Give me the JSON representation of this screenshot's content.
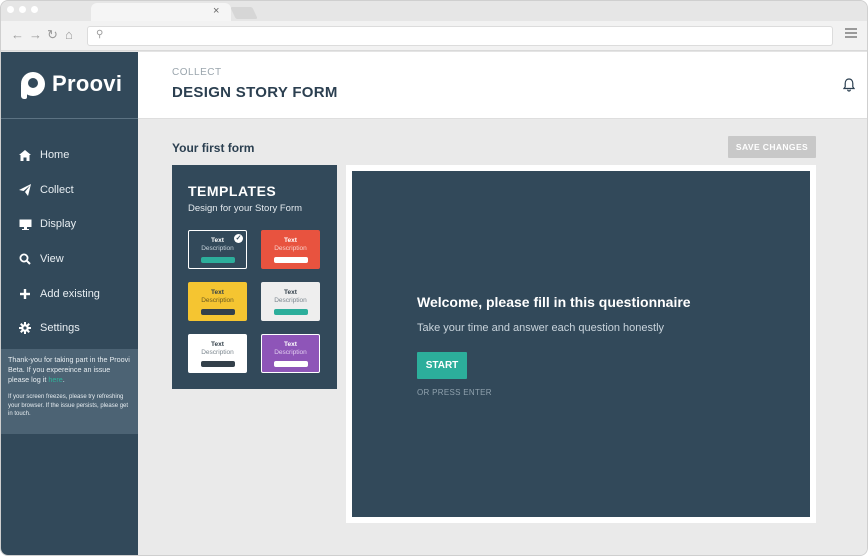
{
  "browser": {
    "tab_close": "×",
    "search_icon": "⚲"
  },
  "brand": {
    "name": "Proovi"
  },
  "sidebar": {
    "items": [
      {
        "label": "Home",
        "icon": "home-icon"
      },
      {
        "label": "Collect",
        "icon": "paper-plane-icon"
      },
      {
        "label": "Display",
        "icon": "monitor-icon"
      },
      {
        "label": "View",
        "icon": "search-icon"
      },
      {
        "label": "Add existing",
        "icon": "plus-icon"
      },
      {
        "label": "Settings",
        "icon": "gear-icon"
      }
    ],
    "notice": {
      "text": "Thank-you for taking part in the Proovi Beta. If you expereince an issue please log it ",
      "link": "here",
      "after_link": ".",
      "small": "If your screen freezes, please try refreshing your browser. If the issue persists, please get in touch."
    }
  },
  "header": {
    "kicker": "COLLECT",
    "title": "DESIGN STORY FORM"
  },
  "form": {
    "title": "Your first form",
    "save_label": "SAVE CHANGES"
  },
  "templates": {
    "heading": "TEMPLATES",
    "subheading": "Design for your Story Form",
    "cards": [
      {
        "title": "Text",
        "desc": "Description",
        "bg": "#32495a",
        "border": "#ffffff",
        "text": "#ffffff",
        "desc_color": "#c5d1d9",
        "bar": "#2cae9b",
        "selected": true
      },
      {
        "title": "Text",
        "desc": "Description",
        "bg": "#e8533f",
        "border": "#e8533f",
        "text": "#ffffff",
        "desc_color": "#f9d2cb",
        "bar": "#ffffff",
        "selected": false
      },
      {
        "title": "Text",
        "desc": "Description",
        "bg": "#f5c531",
        "border": "#f5c531",
        "text": "#33404a",
        "desc_color": "#6a5a20",
        "bar": "#33404a",
        "selected": false
      },
      {
        "title": "Text",
        "desc": "Description",
        "bg": "#eeeeee",
        "border": "#eeeeee",
        "text": "#33404a",
        "desc_color": "#7b868e",
        "bar": "#2cae9b",
        "selected": false
      },
      {
        "title": "Text",
        "desc": "Description",
        "bg": "#ffffff",
        "border": "#ffffff",
        "text": "#33404a",
        "desc_color": "#7b868e",
        "bar": "#33404a",
        "selected": false
      },
      {
        "title": "Text",
        "desc": "Description",
        "bg": "#8e55b8",
        "border": "#ffffff",
        "text": "#ffffff",
        "desc_color": "#e0cdef",
        "bar": "#ffffff",
        "selected": false
      }
    ]
  },
  "preview": {
    "heading": "Welcome, please fill in this questionnaire",
    "subheading": "Take your time and answer each question honestly",
    "start_label": "START",
    "hint": "OR PRESS ENTER"
  },
  "colors": {
    "sidebar": "#32495a",
    "accent": "#2cae9b",
    "save_disabled": "#c8c8c8"
  }
}
